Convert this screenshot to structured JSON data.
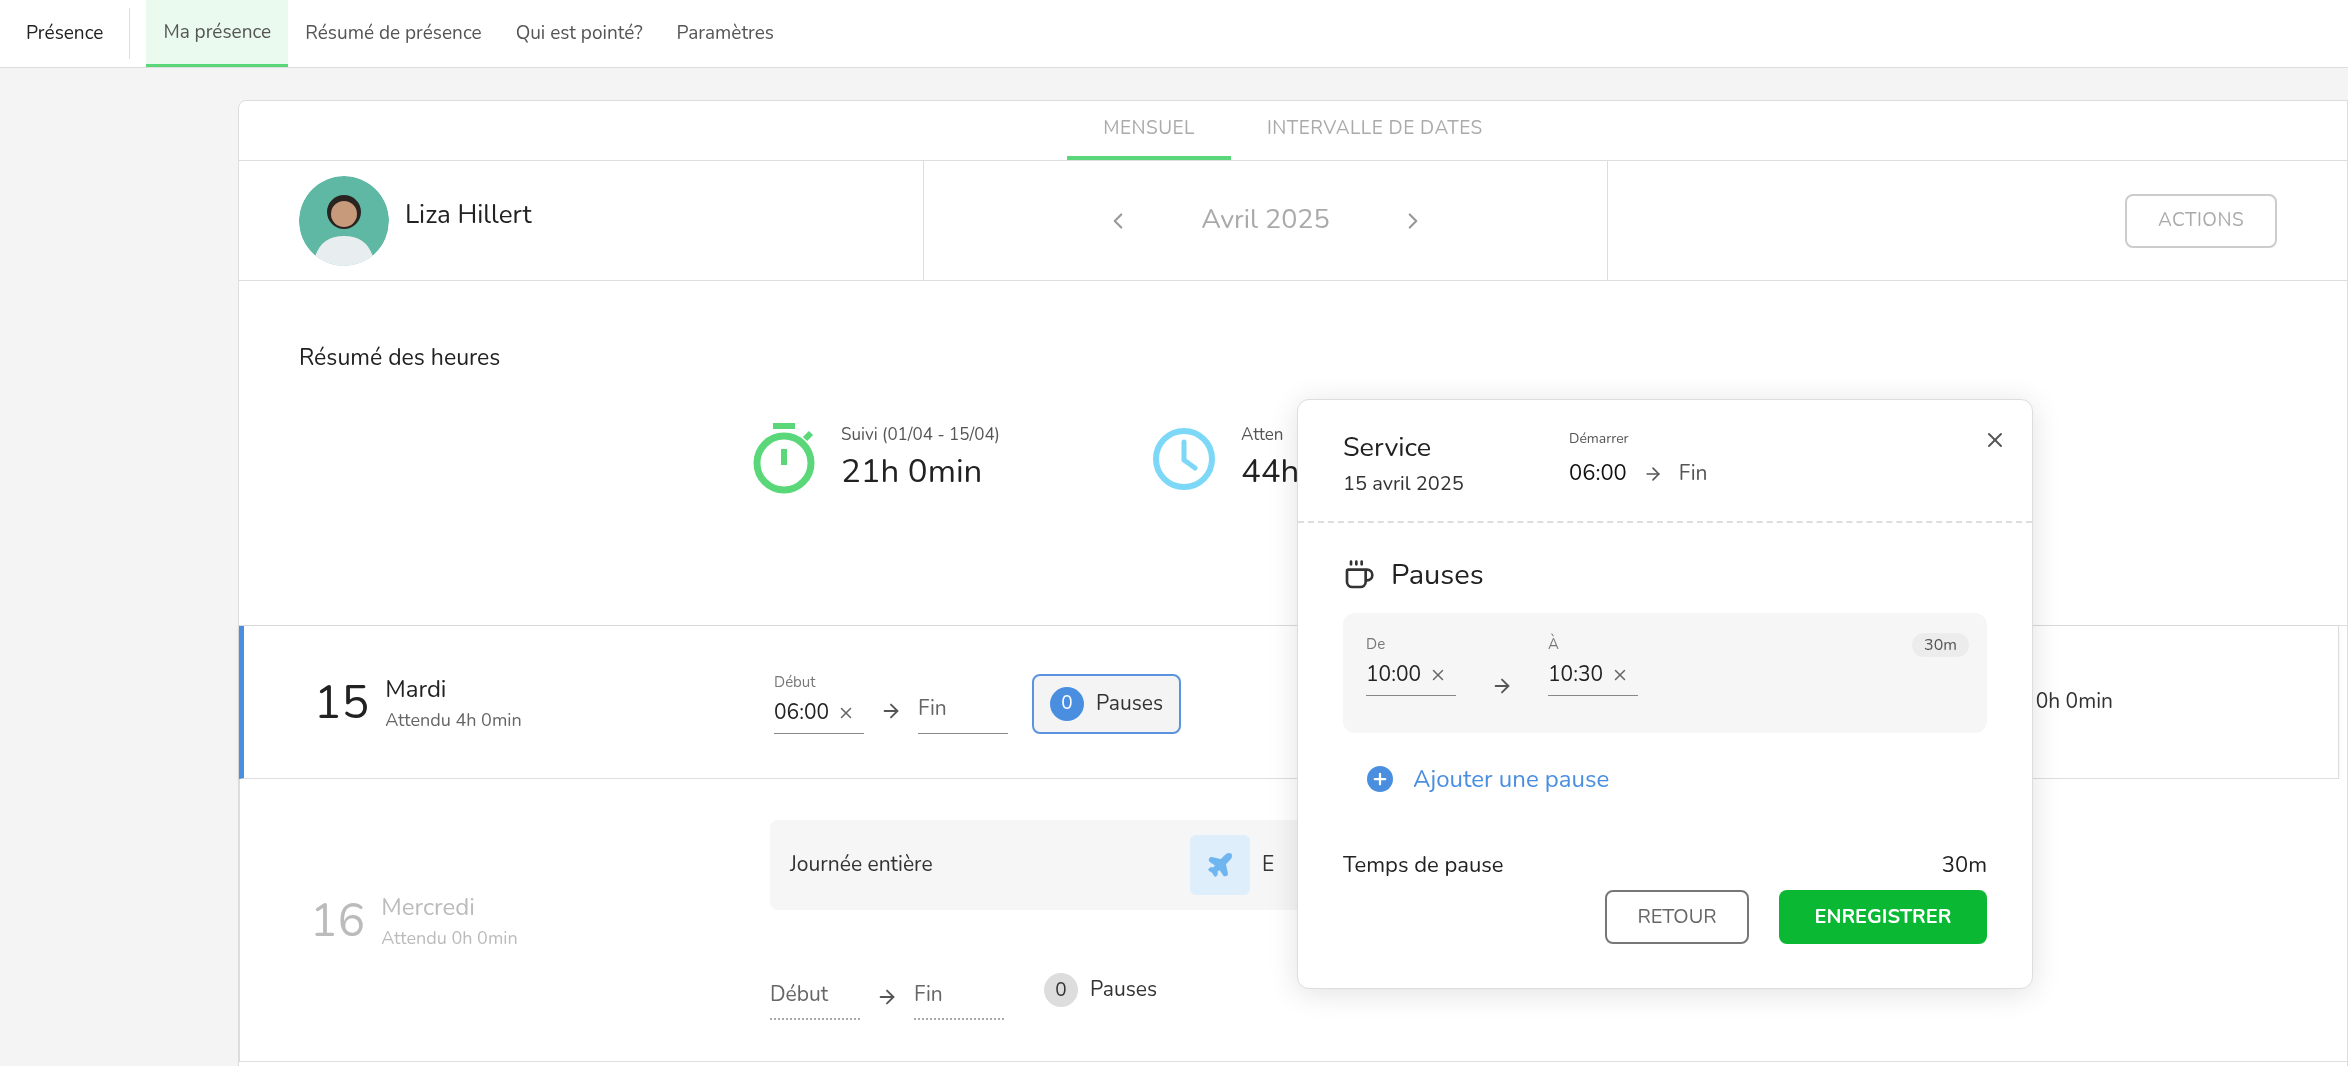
{
  "nav": {
    "title": "Présence",
    "tabs": [
      {
        "label": "Ma présence",
        "selected": true
      },
      {
        "label": "Résumé de présence",
        "selected": false
      },
      {
        "label": "Qui est pointé?",
        "selected": false
      },
      {
        "label": "Paramètres",
        "selected": false
      }
    ]
  },
  "view_tabs": [
    {
      "label": "MENSUEL",
      "selected": true
    },
    {
      "label": "INTERVALLE DE DATES",
      "selected": false
    }
  ],
  "employee": {
    "name": "Liza Hillert"
  },
  "month": "Avril 2025",
  "actions_button": "ACTIONS",
  "summary": {
    "title": "Résumé des heures",
    "stats": [
      {
        "kind": "stopwatch",
        "label": "Suivi (01/04 - 15/04)",
        "value": "21h 0min"
      },
      {
        "kind": "clock",
        "label": "Atten",
        "value": "44h"
      }
    ]
  },
  "days": [
    {
      "number": "15",
      "weekday": "Mardi",
      "expected": "Attendu 4h 0min",
      "selected": true,
      "start": {
        "label": "Début",
        "value": "06:00"
      },
      "end": {
        "placeholder": "Fin"
      },
      "pauses_count": "0",
      "pauses_label": "Pauses",
      "total": "0h 0min"
    },
    {
      "number": "16",
      "weekday": "Mercredi",
      "expected": "Attendu 0h 0min",
      "selected": false,
      "absence": {
        "label": "Journée entière",
        "type": "E"
      },
      "start": {
        "placeholder": "Début"
      },
      "end": {
        "placeholder": "Fin"
      },
      "pauses_count": "0",
      "pauses_label": "Pauses"
    }
  ],
  "popup": {
    "title": "Service",
    "date": "15 avril 2025",
    "start_label": "Démarrer",
    "start": "06:00",
    "end": "Fin",
    "section_title": "Pauses",
    "breaks": [
      {
        "from_label": "De",
        "from": "10:00",
        "to_label": "À",
        "to": "10:30",
        "duration": "30m"
      }
    ],
    "add_break": "Ajouter une pause",
    "total_label": "Temps de pause",
    "total": "30m",
    "buttons": [
      {
        "label": "RETOUR",
        "kind": "secondary"
      },
      {
        "label": "ENREGISTRER",
        "kind": "primary"
      }
    ]
  }
}
